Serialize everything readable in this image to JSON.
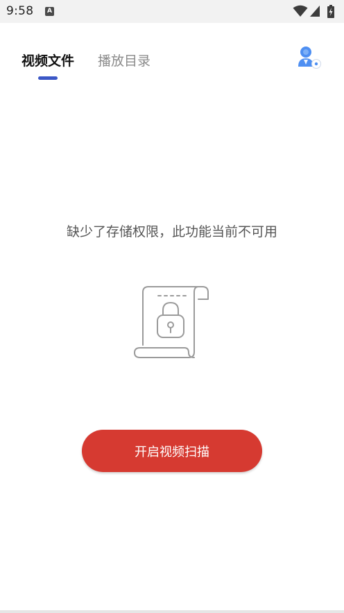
{
  "status_bar": {
    "time": "9:58",
    "notification_icon": "a-icon",
    "wifi_icon": "wifi-icon",
    "signal_icon": "signal-icon",
    "battery_icon": "battery-charging-icon"
  },
  "tabs": [
    {
      "label": "视频文件",
      "selected": true
    },
    {
      "label": "播放目录",
      "selected": false
    }
  ],
  "header": {
    "profile_icon": "user-settings-icon"
  },
  "empty_state": {
    "message": "缺少了存储权限，此功能当前不可用",
    "illustration_icon": "locked-document-icon"
  },
  "action": {
    "scan_button_label": "开启视频扫描"
  },
  "colors": {
    "accent": "#3b57c6",
    "button": "#d63a31",
    "profile_icon": "#4e8ff2",
    "illustration_stroke": "#9a9a9a"
  }
}
